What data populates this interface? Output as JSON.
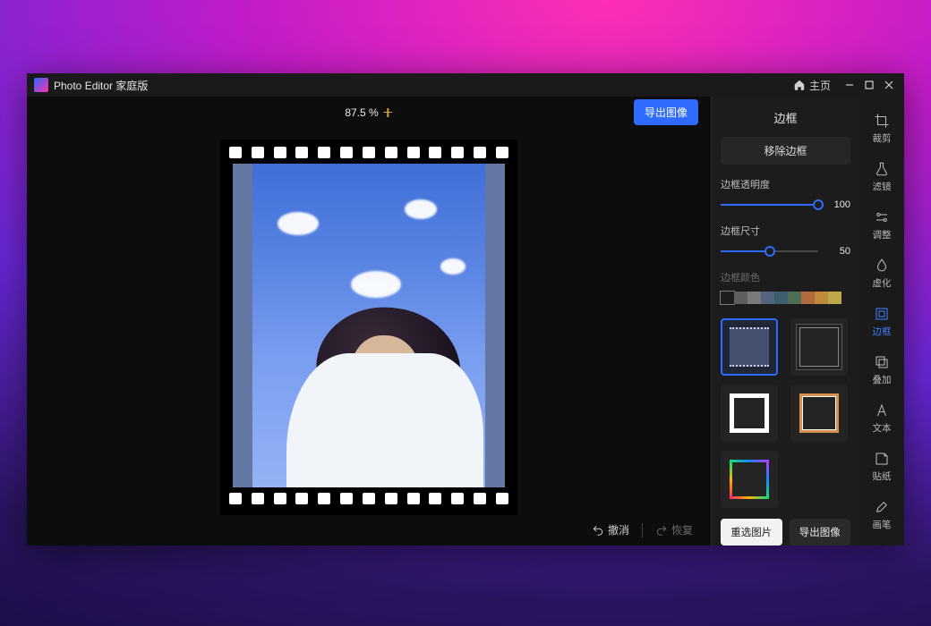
{
  "titlebar": {
    "app_name": "Photo Editor 家庭版",
    "home_label": "主页"
  },
  "canvas": {
    "zoom_label": "87.5 %",
    "export_button": "导出图像",
    "undo_label": "撤消",
    "redo_label": "恢复"
  },
  "panel": {
    "title": "边框",
    "remove_button": "移除边框",
    "opacity_label": "边框透明度",
    "opacity_value": "100",
    "opacity_pct": 100,
    "size_label": "边框尺寸",
    "size_value": "50",
    "size_pct": 50,
    "color_label": "边框颜色",
    "swatches": [
      "#1d1d1d",
      "#5f5f5f",
      "#7a7a7a",
      "#54637e",
      "#3e5d6e",
      "#4e6e55",
      "#b06a3b",
      "#c08a3c",
      "#bfa84a"
    ],
    "frame_options": [
      "film-sprocket",
      "double-line",
      "thick-white",
      "warm-metal",
      "rainbow"
    ],
    "selected_frame": "film-sprocket",
    "reselect_button": "重选图片",
    "export_button": "导出图像"
  },
  "rail": {
    "items": [
      {
        "key": "crop",
        "label": "裁剪"
      },
      {
        "key": "filter",
        "label": "滤镜"
      },
      {
        "key": "adjust",
        "label": "调整"
      },
      {
        "key": "blur",
        "label": "虚化"
      },
      {
        "key": "frame",
        "label": "边框"
      },
      {
        "key": "overlay",
        "label": "叠加"
      },
      {
        "key": "text",
        "label": "文本"
      },
      {
        "key": "sticker",
        "label": "贴纸"
      },
      {
        "key": "brush",
        "label": "画笔"
      }
    ],
    "active": "frame"
  }
}
